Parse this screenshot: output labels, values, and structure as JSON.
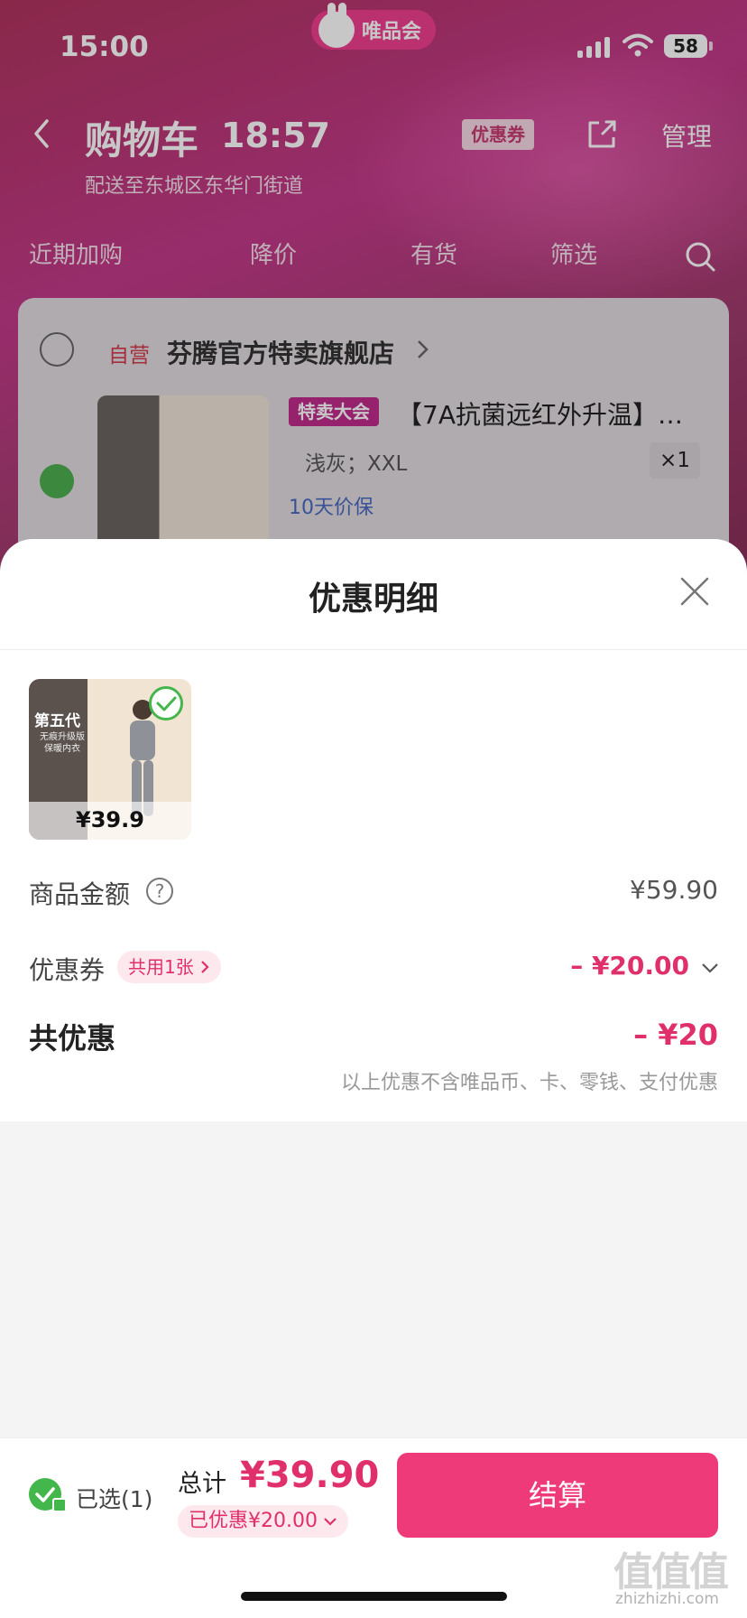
{
  "status_bar": {
    "time": "15:00",
    "app_badge": "唯品会",
    "battery": "58"
  },
  "background_page": {
    "title": "购物车",
    "time": "18:57",
    "coupon_tag": "优惠券",
    "manage": "管理",
    "delivery": "配送至东城区东华门街道",
    "filters": [
      "近期加购",
      "降价",
      "有货",
      "筛选"
    ],
    "store": {
      "self_tag": "自营",
      "name": "芬腾官方特卖旗舰店"
    },
    "product": {
      "sale_tag": "特卖大会",
      "title": "【7A抗菌远红外升温】…",
      "spec": "浅灰；XXL",
      "qty": "×1",
      "guarantee": "10天价保"
    }
  },
  "sheet": {
    "title": "优惠明细",
    "thumb": {
      "line1": "第五代",
      "line2": "无痕升级版 保暖内衣",
      "price": "¥39.9"
    },
    "goods_amount_label": "商品金额",
    "goods_amount_value": "¥59.90",
    "coupon_label": "优惠券",
    "coupon_shared": "共用1张",
    "coupon_value": "– ¥20.00",
    "total_label": "共优惠",
    "total_value": "– ¥20",
    "note": "以上优惠不含唯品币、卡、零钱、支付优惠"
  },
  "bottom_bar": {
    "selected": "已选(1)",
    "sum_label": "总计",
    "sum_value": "¥39.90",
    "discount": "已优惠¥20.00",
    "checkout": "结算"
  },
  "watermark": {
    "big": "值值值",
    "small": "zhizhizhi.com"
  },
  "colors": {
    "accent": "#ee3a78",
    "accent_text": "#e0306c",
    "success": "#43b64c"
  }
}
